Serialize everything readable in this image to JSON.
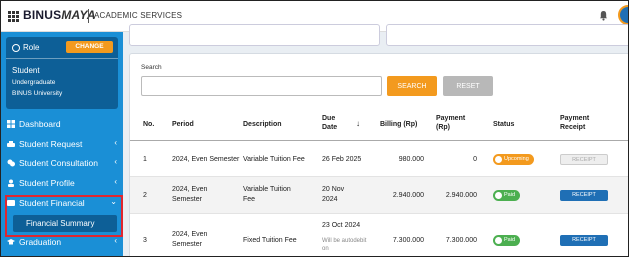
{
  "header": {
    "logo_main": "BINUS",
    "logo_accent": "MAYA",
    "title": "ACADEMIC SERVICES"
  },
  "sidebar": {
    "role_label": "Role",
    "change_label": "CHANGE",
    "user_role": "Student",
    "user_level": "Undergraduate",
    "user_org": "BINUS University",
    "items": [
      {
        "label": "Dashboard",
        "icon": "dashboard-icon"
      },
      {
        "label": "Student Request",
        "icon": "hand-icon"
      },
      {
        "label": "Student Consultation",
        "icon": "chat-icon"
      },
      {
        "label": "Student Profile",
        "icon": "user-icon"
      },
      {
        "label": "Student Financial",
        "icon": "wallet-icon"
      },
      {
        "label": "Financial Summary"
      },
      {
        "label": "Graduation",
        "icon": "graduation-cap-icon"
      }
    ]
  },
  "search": {
    "label": "Search",
    "placeholder": "",
    "value": "",
    "search_button": "SEARCH",
    "reset_button": "RESET"
  },
  "table": {
    "columns": [
      "No.",
      "Period",
      "Description",
      "Due Date",
      "Billing (Rp)",
      "Payment (Rp)",
      "Status",
      "Payment Receipt"
    ],
    "rows": [
      {
        "no": "1",
        "period": "2024, Even Semester",
        "description": "Variable Tuition Fee",
        "due_date": "26 Feb 2025",
        "due_note": "",
        "billing": "980.000",
        "payment": "0",
        "status": "Upcoming",
        "receipt": "RECEIPT"
      },
      {
        "no": "2",
        "period": "2024, Even Semester",
        "description": "Variable Tuition Fee",
        "due_date": "20 Nov 2024",
        "due_note": "",
        "billing": "2.940.000",
        "payment": "2.940.000",
        "status": "Paid",
        "receipt": "RECEIPT"
      },
      {
        "no": "3",
        "period": "2024, Even Semester",
        "description": "Fixed Tuition Fee",
        "due_date": "23 Oct 2024",
        "due_note": "Will be autodebit on",
        "billing": "7.300.000",
        "payment": "7.300.000",
        "status": "Paid",
        "receipt": "RECEIPT"
      }
    ]
  },
  "colors": {
    "sidebar": "#1a8fd6",
    "accent": "#f39a1e",
    "paid": "#4caf50",
    "primary": "#1f6fb5",
    "highlight_border": "#e0262f"
  }
}
